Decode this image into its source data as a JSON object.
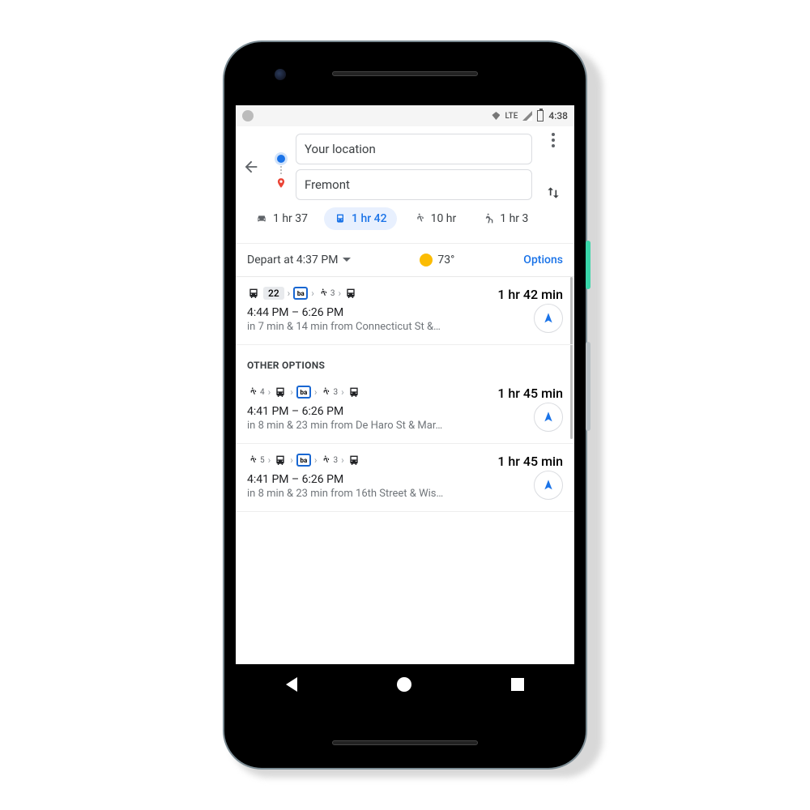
{
  "statusbar": {
    "network": "LTE",
    "time": "4:38"
  },
  "header": {
    "origin": "Your location",
    "destination": "Fremont"
  },
  "modes": {
    "car": "1 hr 37",
    "transit": "1 hr 42",
    "walk": "10 hr",
    "ride": "1 hr 3"
  },
  "depart": {
    "label": "Depart at 4:37 PM",
    "temp": "73°",
    "options": "Options"
  },
  "routes": [
    {
      "bus_badge": "22",
      "walk_sub": "3",
      "duration": "1 hr 42 min",
      "time": "4:44 PM – 6:26 PM",
      "detail": "in 7 min & 14 min from Connecticut St &…"
    }
  ],
  "other_header": "OTHER OPTIONS",
  "other": [
    {
      "walk1_sub": "4",
      "walk2_sub": "3",
      "duration": "1 hr 45 min",
      "time": "4:41 PM – 6:26 PM",
      "detail": "in 8 min & 23 min from De Haro St & Mar…"
    },
    {
      "walk1_sub": "5",
      "walk2_sub": "3",
      "duration": "1 hr 45 min",
      "time": "4:41 PM – 6:26 PM",
      "detail": "in 8 min & 23 min from 16th Street & Wis…"
    }
  ],
  "bart_label": "ba"
}
